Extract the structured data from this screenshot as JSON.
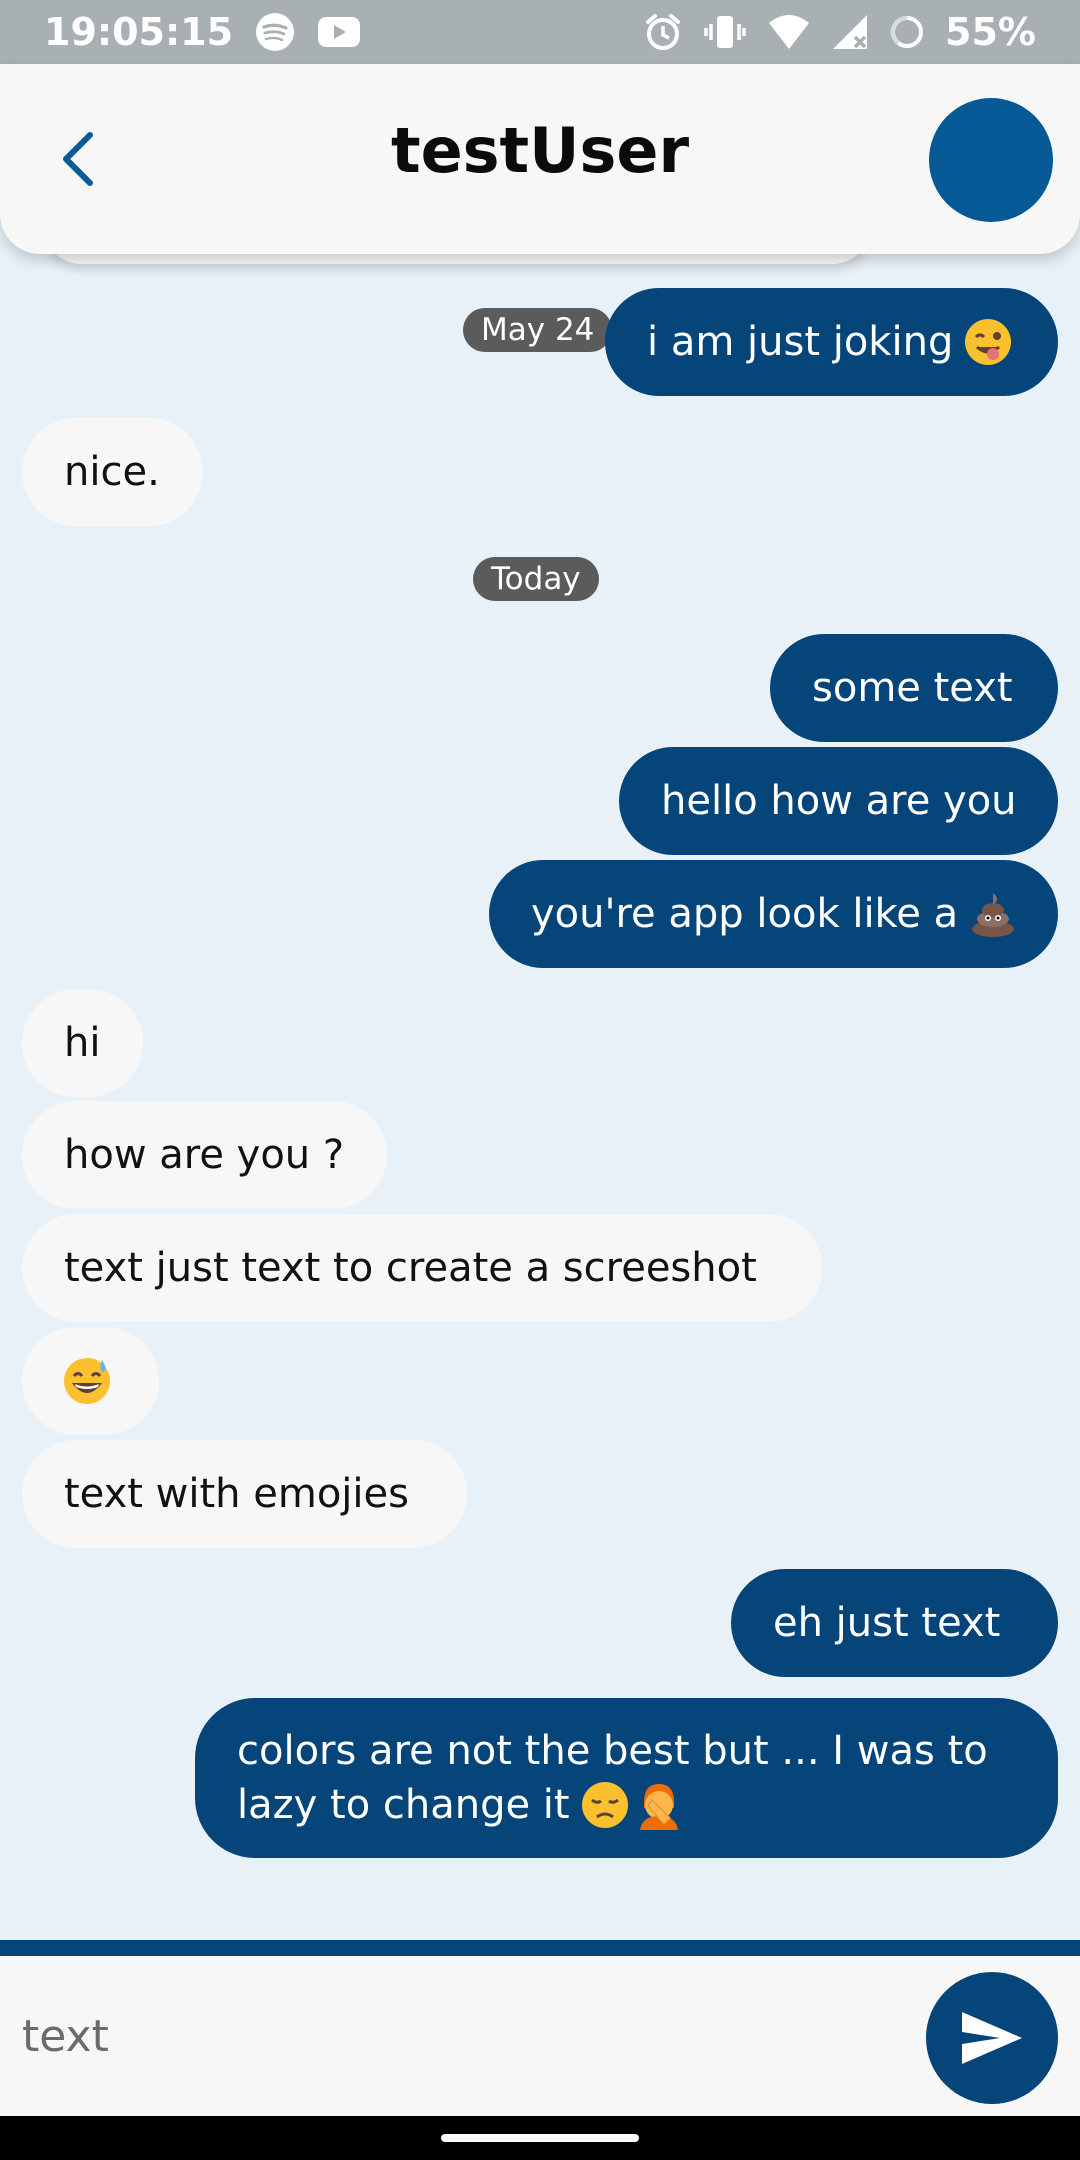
{
  "status_bar": {
    "time": "19:05:15",
    "battery": "55%",
    "icons": [
      "spotify-icon",
      "youtube-icon",
      "alarm-icon",
      "vibrate-icon",
      "wifi-icon",
      "signal-icon",
      "battery-icon"
    ]
  },
  "header": {
    "title": "testUser",
    "back_icon": "chevron-left-icon",
    "avatar_color": "#055a96"
  },
  "colors": {
    "outgoing_bubble": "#05457a",
    "incoming_bubble": "#f7f7f7",
    "background": "#e8f1f7",
    "date_chip": "#5b5b5b"
  },
  "messages": {
    "m1": {
      "text": "i am just joking",
      "emoji": "winking-tongue-emoji",
      "direction": "out"
    },
    "d1": {
      "text": "May 24"
    },
    "m2": {
      "text": "nice.",
      "direction": "in"
    },
    "d2": {
      "text": "Today"
    },
    "m3": {
      "text": "some text",
      "direction": "out"
    },
    "m4": {
      "text": "hello how are you",
      "direction": "out"
    },
    "m5": {
      "text": "you're app look like a",
      "emoji": "poop-emoji",
      "direction": "out"
    },
    "m6": {
      "text": "hi",
      "direction": "in"
    },
    "m7": {
      "text": "how are you ?",
      "direction": "in"
    },
    "m8": {
      "text": "text just text to create a screeshot",
      "direction": "in"
    },
    "m9": {
      "emoji": "grinning-sweat-emoji",
      "direction": "in"
    },
    "m10": {
      "text": "text with emojies",
      "direction": "in"
    },
    "m11": {
      "text": "eh just text",
      "direction": "out"
    },
    "m12": {
      "line1": "colors are not the best but ... I was to",
      "line2": "lazy to change it",
      "emojis": [
        "disappointed-emoji",
        "facepalm-emoji"
      ],
      "direction": "out"
    }
  },
  "composer": {
    "placeholder": "text",
    "send_icon": "send-icon"
  }
}
